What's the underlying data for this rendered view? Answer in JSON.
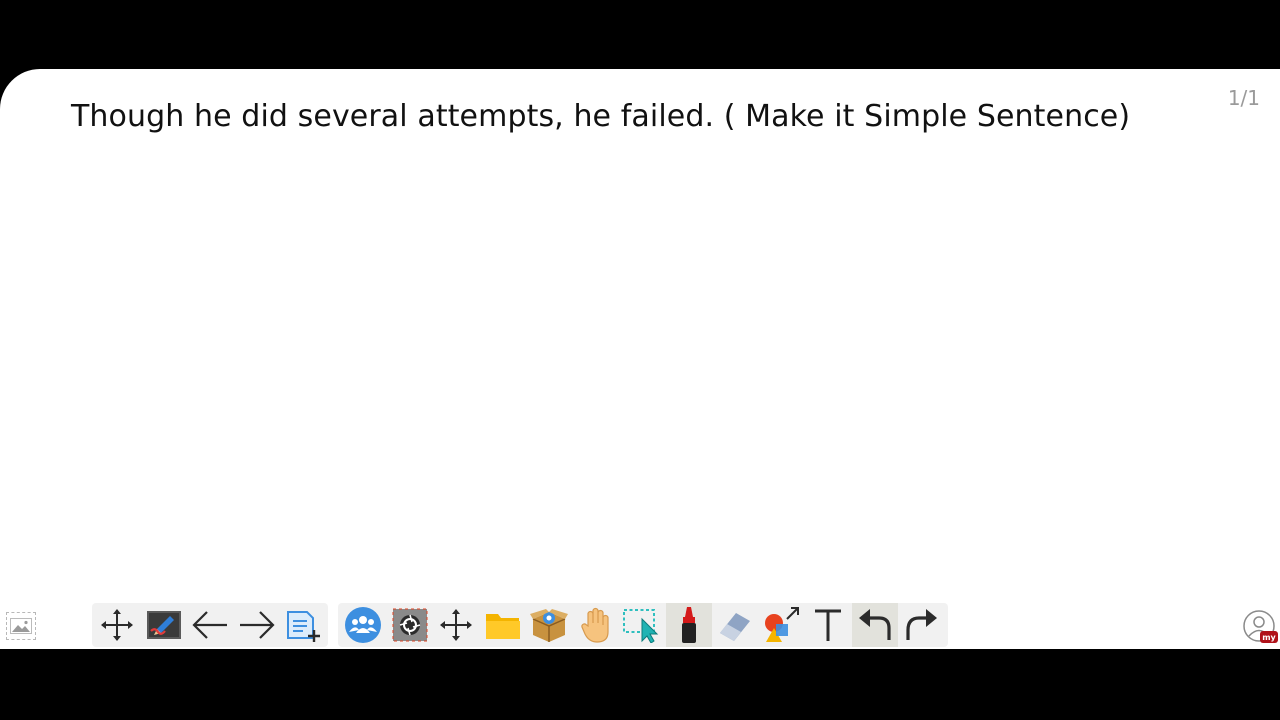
{
  "board": {
    "question_text": "Though he did several attempts, he failed. ( Make it Simple Sentence)",
    "page_counter": "1/1"
  },
  "toolbar_left": {
    "icons": [
      "move-arrows-icon",
      "pen-settings-icon",
      "arrow-left-icon",
      "arrow-right-icon",
      "add-page-icon"
    ]
  },
  "toolbar_right": {
    "icons": [
      "users-group-icon",
      "camera-shutter-icon",
      "move-arrows-icon",
      "folder-icon",
      "resource-box-icon",
      "hand-icon",
      "select-cursor-icon",
      "marker-icon",
      "eraser-icon",
      "shapes-icon",
      "text-tool-icon",
      "undo-icon",
      "redo-icon"
    ],
    "active": [
      "marker",
      "undo"
    ]
  },
  "profile": {
    "badge_text": "my"
  },
  "colors": {
    "background": "#000000",
    "board": "#ffffff",
    "toolbar": "#f1f1f1",
    "accent_blue": "#3d8fe0",
    "marker_red": "#d41a1a"
  }
}
